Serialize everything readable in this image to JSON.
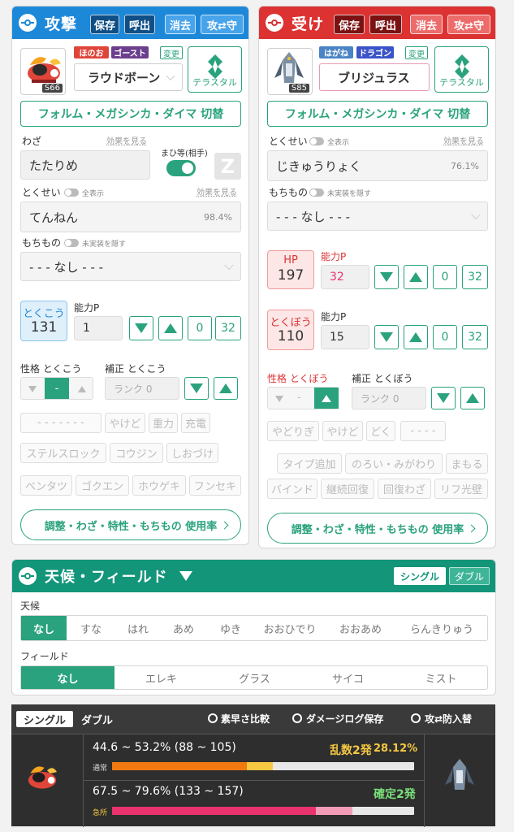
{
  "attack": {
    "title": "攻撃",
    "buttons": {
      "save": "保存",
      "load": "呼出",
      "clear": "消去",
      "swap": "攻⇄守"
    },
    "types": [
      {
        "label": "ほのお",
        "color": "#e0453a"
      },
      {
        "label": "ゴースト",
        "color": "#6b3f8e"
      }
    ],
    "change_label": "変更",
    "level_badge": "S66",
    "pokemon": "ラウドボーン",
    "terastal_label": "テラスタル",
    "forme_button": "フォルム・メガシンカ・ダイマ 切替",
    "move_label": "わざ",
    "move_effect_link": "効果を見る",
    "move_value": "たたりめ",
    "paralysis_label": "まひ等(相手)",
    "z_label": "Z",
    "ability_label": "とくせい",
    "show_all_label": "全表示",
    "ability_effect_link": "効果を見る",
    "ability_value": "てんねん",
    "ability_pct": "98.4%",
    "item_label": "もちもの",
    "hide_unimpl_label": "未実装を隠す",
    "item_value": "- - - なし - - -",
    "stat_name": "とくこう",
    "stat_value": "131",
    "ev_label": "能力P",
    "ev_value": "1",
    "ev_zero": "0",
    "ev_max": "32",
    "nature_label": "性格 とくこう",
    "nature_mid": "-",
    "rank_label": "補正 とくこう",
    "rank_placeholder": "ランク 0",
    "chips_row1": [
      "- - - - - - -",
      "やけど",
      "重力",
      "充電"
    ],
    "chips_row2": [
      "ステルスロック",
      "コウジン",
      "しおづけ"
    ],
    "chips_row3": [
      "ベンタツ",
      "ゴクエン",
      "ホウゲキ",
      "フンセキ"
    ],
    "usage_link": "調整・わざ・特性・もちもの 使用率"
  },
  "defense": {
    "title": "受け",
    "buttons": {
      "save": "保存",
      "load": "呼出",
      "clear": "消去",
      "swap": "攻⇄守"
    },
    "types": [
      {
        "label": "はがね",
        "color": "#4a84c4"
      },
      {
        "label": "ドラゴン",
        "color": "#3b54c9"
      }
    ],
    "change_label": "変更",
    "level_badge": "S85",
    "pokemon": "ブリジュラス",
    "terastal_label": "テラスタル",
    "forme_button": "フォルム・メガシンカ・ダイマ 切替",
    "ability_label": "とくせい",
    "show_all_label": "全表示",
    "ability_effect_link": "効果を見る",
    "ability_value": "じきゅうりょく",
    "ability_pct": "76.1%",
    "item_label": "もちもの",
    "hide_unimpl_label": "未実装を隠す",
    "item_value": "- - - なし - - -",
    "hp_name": "HP",
    "hp_value": "197",
    "ev_label": "能力P",
    "hp_ev": "32",
    "ev_zero": "0",
    "ev_max": "32",
    "stat_name": "とくぼう",
    "stat_value": "110",
    "def_ev": "15",
    "nature_label": "性格 とくぼう",
    "nature_mid": "-",
    "rank_label": "補正 とくぼう",
    "rank_placeholder": "ランク 0",
    "chips_row1": [
      "やどりぎ",
      "やけど",
      "どく",
      "- - - -"
    ],
    "chips_row2": [
      "タイプ追加",
      "のろい・みがわり",
      "まもる"
    ],
    "chips_row3": [
      "バインド",
      "継続回復",
      "回復わざ",
      "リフ光壁"
    ],
    "usage_link": "調整・わざ・特性・もちもの 使用率"
  },
  "weather_panel": {
    "title": "天候・フィールド",
    "single_label": "シングル",
    "double_label": "ダブル",
    "weather_label": "天候",
    "weather_options": [
      "なし",
      "すな",
      "はれ",
      "あめ",
      "ゆき",
      "おおひでり",
      "おおあめ",
      "らんきりゅう"
    ],
    "weather_selected": "なし",
    "field_label": "フィールド",
    "field_options": [
      "なし",
      "エレキ",
      "グラス",
      "サイコ",
      "ミスト"
    ],
    "field_selected": "なし"
  },
  "result": {
    "tab_single": "シングル",
    "tab_double": "ダブル",
    "speed_compare": "素早さ比較",
    "save_log": "ダメージログ保存",
    "swap_label": "攻⇄防入替",
    "normal": {
      "range_text": "44.6 ~ 53.2% (88 ~ 105)",
      "tag": "通常",
      "verdict": "乱数2発",
      "chance": "28.12%",
      "min_fraction": 0.446,
      "max_fraction": 0.532,
      "color_main": "#f07a10",
      "color_range": "#f5c842"
    },
    "crit": {
      "range_text": "67.5 ~ 79.6% (133 ~ 157)",
      "tag": "急所",
      "verdict": "確定2発",
      "min_fraction": 0.675,
      "max_fraction": 0.796,
      "color_main": "#e8336e",
      "color_range": "#f29cb8"
    }
  },
  "colors": {
    "attack": "#1e88d8",
    "defense": "#dc3232",
    "accent": "#2aa27d"
  }
}
